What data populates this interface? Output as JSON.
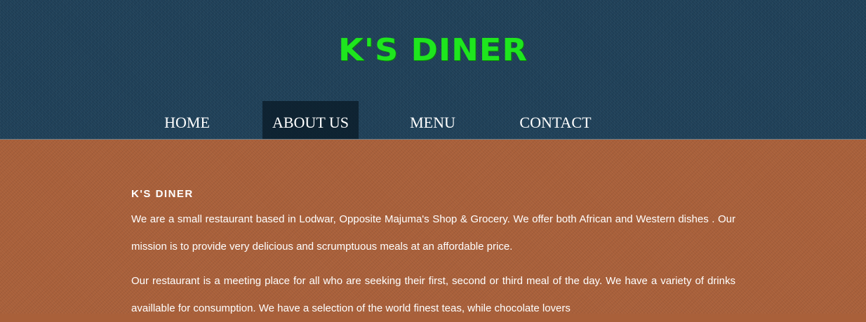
{
  "header": {
    "site_title": "K'S DINER",
    "title_color": "#1ee61e",
    "background_color": "#1f4058"
  },
  "nav": {
    "items": [
      {
        "label": "HOME",
        "active": false
      },
      {
        "label": "ABOUT US",
        "active": true
      },
      {
        "label": "MENU",
        "active": false
      },
      {
        "label": "CONTACT",
        "active": false
      }
    ]
  },
  "main": {
    "background_color": "#a9603a",
    "heading": "K'S DINER",
    "paragraphs": [
      "We are a small restaurant based in Lodwar, Opposite Majuma's Shop & Grocery. We offer both African and Western dishes . Our mission is to provide very delicious and scrumptuous meals at an affordable price.",
      "Our restaurant is a meeting place for all who are seeking their first, second or third meal of the day. We have a variety of drinks availlable for consumption. We have a selection of the world finest teas, while chocolate lovers"
    ]
  }
}
